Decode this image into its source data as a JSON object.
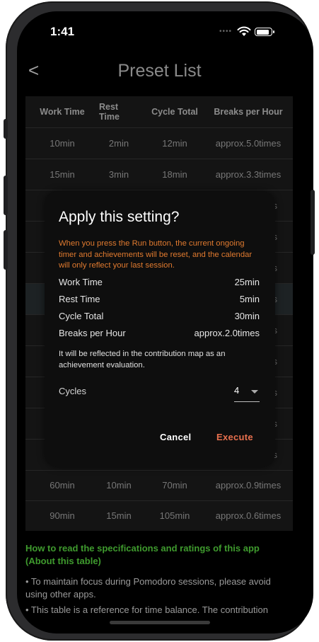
{
  "status": {
    "time": "1:41"
  },
  "nav": {
    "title": "Preset List",
    "back": "<"
  },
  "table": {
    "headers": [
      "Work Time",
      "Rest Time",
      "Cycle Total",
      "Breaks per Hour"
    ],
    "rows": [
      [
        "10min",
        "2min",
        "12min",
        "approx.5.0times"
      ],
      [
        "15min",
        "3min",
        "18min",
        "approx.3.3times"
      ],
      [
        "",
        "",
        "",
        "s"
      ],
      [
        "",
        "",
        "",
        "s"
      ],
      [
        "",
        "",
        "",
        "s"
      ],
      [
        "",
        "",
        "",
        "s"
      ],
      [
        "",
        "",
        "",
        "s"
      ],
      [
        "",
        "",
        "",
        "s"
      ],
      [
        "",
        "",
        "",
        "s"
      ],
      [
        "",
        "",
        "",
        "s"
      ],
      [
        "",
        "",
        "",
        "s"
      ],
      [
        "60min",
        "10min",
        "70min",
        "approx.0.9times"
      ],
      [
        "90min",
        "15min",
        "105min",
        "approx.0.6times"
      ]
    ]
  },
  "dialog": {
    "title": "Apply this setting?",
    "warning": "When you press the Run button, the current ongoing timer and achievements will be reset, and the calendar will only reflect your last session.",
    "fields": [
      {
        "label": "Work Time",
        "value": "25min"
      },
      {
        "label": "Rest Time",
        "value": "5min"
      },
      {
        "label": "Cycle Total",
        "value": "30min"
      },
      {
        "label": "Breaks per Hour",
        "value": "approx.2.0times"
      }
    ],
    "note": "It will be reflected in the contribution map as an achievement evaluation.",
    "cycles_label": "Cycles",
    "cycles_value": "4",
    "cancel": "Cancel",
    "execute": "Execute"
  },
  "info": {
    "title": "How to read the specifications and ratings of this app (About this table)",
    "bullets": [
      "• To maintain focus during Pomodoro sessions, please avoid using other apps.",
      "• This table is a reference for time balance. The contribution"
    ]
  },
  "colors": {
    "accent_orange": "#e07a2f",
    "execute": "#e8704e",
    "info_green": "#3f9b2e"
  }
}
